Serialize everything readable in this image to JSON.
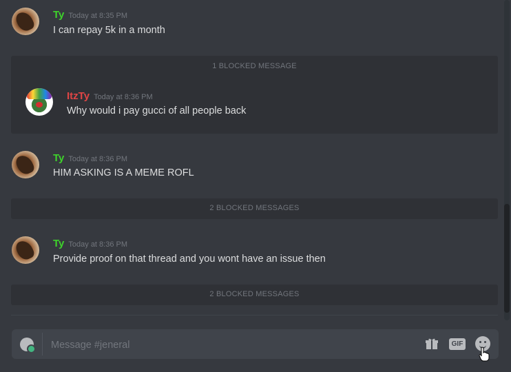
{
  "channel": {
    "name": "jeneral"
  },
  "messages": [
    {
      "user": "Ty",
      "user_color": "#3ed22b",
      "time": "Today at 8:35 PM",
      "text": "I can repay 5k in a month"
    },
    {
      "user": "ItzTy",
      "user_color": "#e04545",
      "time": "Today at 8:36 PM",
      "text": "Why would i pay gucci of all people back"
    },
    {
      "user": "Ty",
      "user_color": "#3ed22b",
      "time": "Today at 8:36 PM",
      "text": "HIM ASKING IS A MEME ROFL"
    },
    {
      "user": "Ty",
      "user_color": "#3ed22b",
      "time": "Today at 8:36 PM",
      "text": "Provide proof on that thread and you wont have an issue then"
    }
  ],
  "blocked": [
    {
      "label": "1 BLOCKED MESSAGE"
    },
    {
      "label": "2 BLOCKED MESSAGES"
    },
    {
      "label": "2 BLOCKED MESSAGES"
    }
  ],
  "composer": {
    "placeholder": "Message #jeneral",
    "gif_label": "GIF"
  },
  "icons": {
    "upload": "plus-circle-icon",
    "gift": "gift-icon",
    "gif": "gif-icon",
    "emoji": "emoji-smile-icon",
    "cursor": "hand-pointer-icon"
  },
  "colors": {
    "background": "#36393f",
    "blocked_bg": "#2f3136",
    "input_bg": "#40444b",
    "text": "#dcddde",
    "muted": "#72767d"
  }
}
